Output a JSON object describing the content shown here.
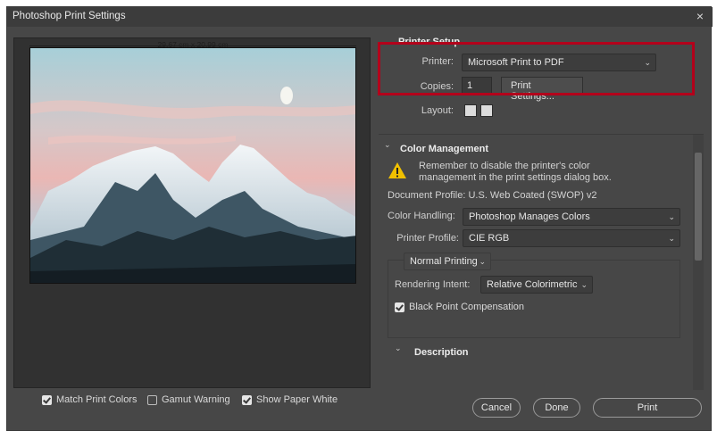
{
  "window": {
    "title": "Photoshop Print Settings",
    "close_glyph": "×"
  },
  "preview": {
    "dimension": "29,67 cm x 20,99 cm",
    "image_desc_icon": "mountain-photo",
    "options": {
      "match_print_colors": {
        "label": "Match Print Colors",
        "checked": true
      },
      "gamut_warning": {
        "label": "Gamut Warning",
        "checked": false
      },
      "show_paper_white": {
        "label": "Show Paper White",
        "checked": true
      }
    }
  },
  "printer_setup": {
    "title": "Printer Setup",
    "printer_label": "Printer:",
    "printer_value": "Microsoft Print to PDF",
    "copies_label": "Copies:",
    "copies_value": "1",
    "print_settings_label": "Print Settings...",
    "layout_label": "Layout:"
  },
  "color_management": {
    "title": "Color Management",
    "warning": "Remember to disable the printer's color management in the print settings dialog box.",
    "document_profile": "Document Profile: U.S. Web Coated (SWOP) v2",
    "color_handling_label": "Color Handling:",
    "color_handling_value": "Photoshop Manages Colors",
    "printer_profile_label": "Printer Profile:",
    "printer_profile_value": "CIE RGB",
    "normal_printing": "Normal Printing",
    "rendering_intent_label": "Rendering Intent:",
    "rendering_intent_value": "Relative Colorimetric",
    "bpc_label": "Black Point Compensation",
    "bpc_checked": true
  },
  "description": {
    "title": "Description"
  },
  "buttons": {
    "cancel": "Cancel",
    "done": "Done",
    "print": "Print"
  },
  "colors": {
    "highlight": "#b3001b",
    "window_bg": "#474747",
    "warning": "#f0c000"
  }
}
